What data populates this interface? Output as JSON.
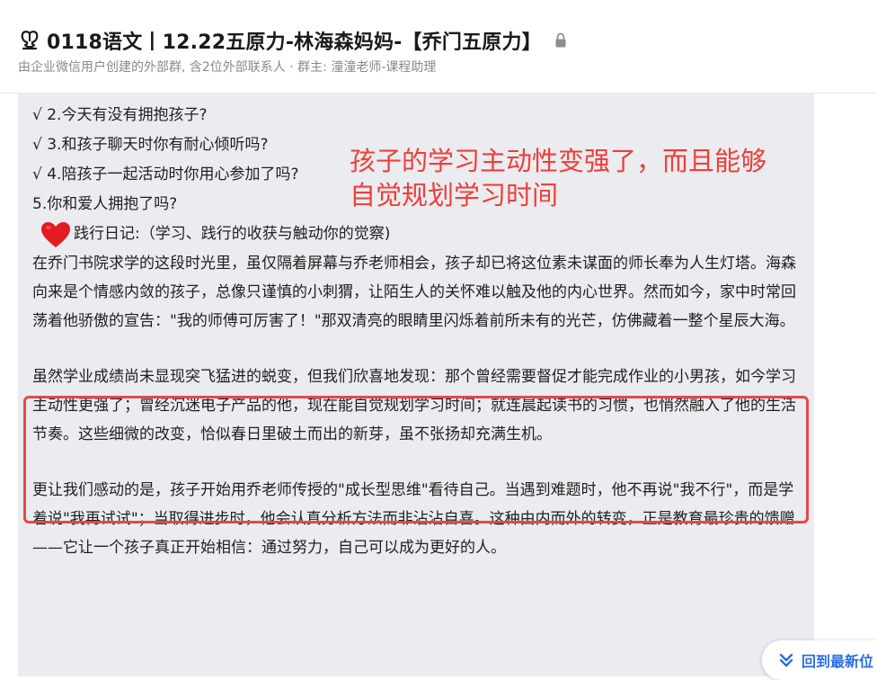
{
  "header": {
    "title": "0118语文丨12.22五原力-林海森妈妈-【乔门五原力】",
    "subtitle": "由企业微信用户创建的外部群, 含2位外部联系人 · 群主: 潼潼老师-课程助理"
  },
  "message": {
    "checklist": [
      "√ 2.今天有没有拥抱孩子?",
      "√ 3.和孩子聊天时你有耐心倾听吗?",
      "√ 4.陪孩子一起活动时你用心参加了吗?",
      "5.你和爱人拥抱了吗?"
    ],
    "diary_label": "践行日记:（学习、践行的收获与触动你的觉察)",
    "paragraph1": "在乔门书院求学的这段时光里，虽仅隔着屏幕与乔老师相会，孩子却已将这位素未谋面的师长奉为人生灯塔。海森向来是个情感内敛的孩子，总像只谨慎的小刺猬，让陌生人的关怀难以触及他的内心世界。然而如今，家中时常回荡着他骄傲的宣告：\"我的师傅可厉害了！\"那双清亮的眼睛里闪烁着前所未有的光芒，仿佛藏着一整个星辰大海。",
    "paragraph2": "虽然学业成绩尚未显现突飞猛进的蜕变，但我们欣喜地发现：那个曾经需要督促才能完成作业的小男孩，如今学习主动性更强了；曾经沉迷电子产品的他，现在能自觉规划学习时间；就连晨起读书的习惯，也悄然融入了他的生活节奏。这些细微的改变，恰似春日里破土而出的新芽，虽不张扬却充满生机。",
    "paragraph3": "更让我们感动的是，孩子开始用乔老师传授的\"成长型思维\"看待自己。当遇到难题时，他不再说\"我不行\"，而是学着说\"我再试试\"；当取得进步时，他会认真分析方法而非沾沾自喜。这种由内而外的转变，正是教育最珍贵的馈赠——它让一个孩子真正开始相信：通过努力，自己可以成为更好的人。"
  },
  "annotation": {
    "text": "孩子的学习主动性变强了，而且能够自觉规划学习时间",
    "color": "#ef3e3a"
  },
  "scroll_button": {
    "label": "回到最新位"
  },
  "icons": {
    "title_icon": "tulip-icon",
    "lock": "lock-icon",
    "heart": "heart-icon",
    "scroll": "double-chevron-down-icon"
  },
  "colors": {
    "highlight_border": "#e5474d",
    "message_bg": "#eaecef",
    "link_blue": "#2b6de5"
  }
}
